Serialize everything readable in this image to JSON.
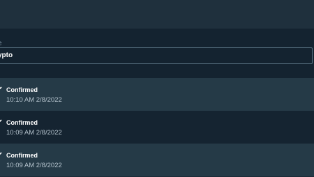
{
  "filter": {
    "label": "e",
    "value": "ypto"
  },
  "transactions": [
    {
      "status": "Confirmed",
      "timestamp": "10:10 AM 2/8/2022"
    },
    {
      "status": "Confirmed",
      "timestamp": "10:09 AM 2/8/2022"
    },
    {
      "status": "Confirmed",
      "timestamp": "10:09 AM 2/8/2022"
    }
  ],
  "colors": {
    "background": "#1c2b38",
    "row_alt": "#253a47",
    "row_dark": "#152431",
    "field_border": "#5a7383",
    "text_primary": "#ffffff",
    "text_secondary": "#b4c2cc"
  },
  "icons": {
    "row_icon": "chevron-icon"
  }
}
